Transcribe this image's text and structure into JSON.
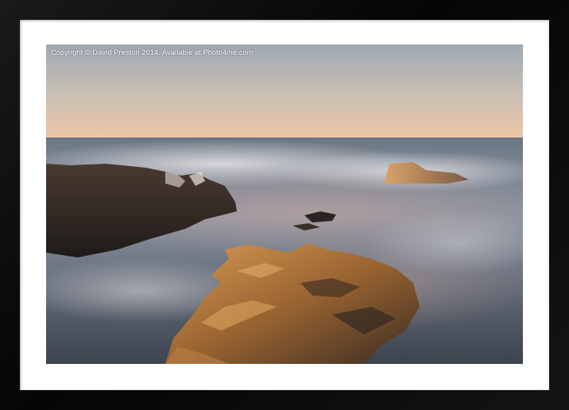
{
  "product": {
    "copyright_text": "Copyright © David Preston 2014. Available at Photo4me.com"
  },
  "colors": {
    "frame": "#0b0b0b",
    "mount": "#ffffff",
    "sky_top": "#a9b2bb",
    "sky_horizon": "#e9c6a6",
    "sea": "#6f7a88",
    "rock_lit": "#c48a4a"
  }
}
